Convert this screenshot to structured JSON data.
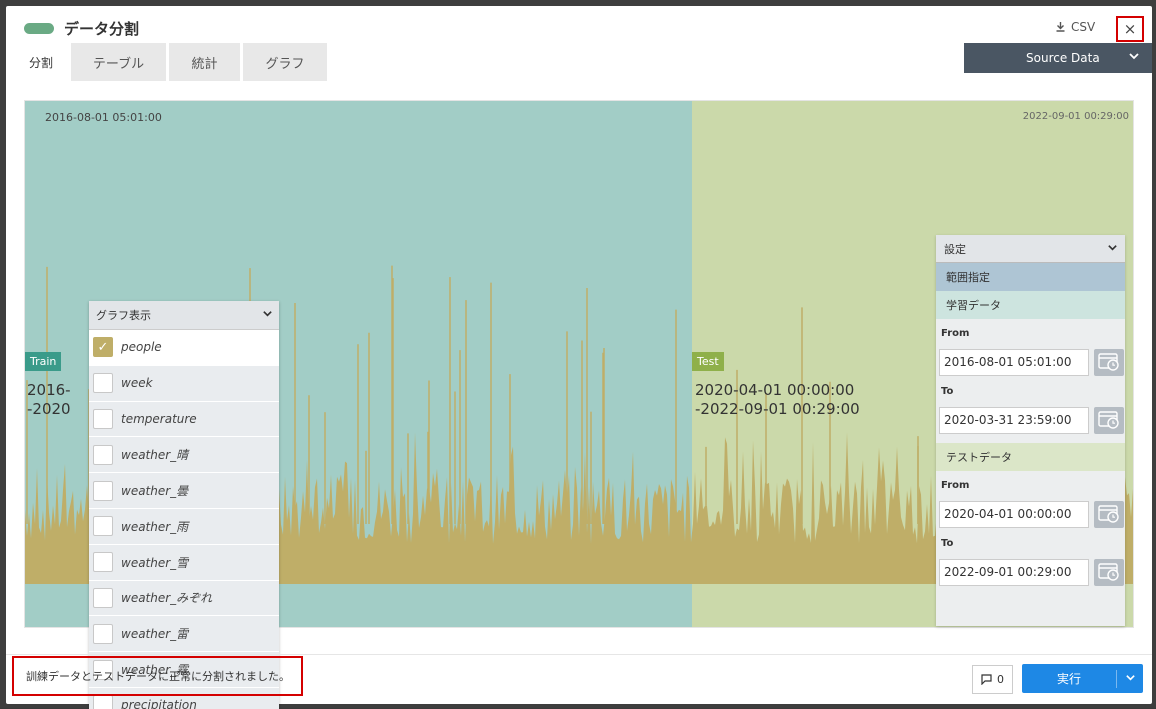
{
  "dialog": {
    "title": "データ分割",
    "csv_label": "CSV",
    "close_label": "×"
  },
  "tabs": [
    {
      "label": "分割"
    },
    {
      "label": "テーブル"
    },
    {
      "label": "統計"
    },
    {
      "label": "グラフ"
    }
  ],
  "source_select": {
    "label": "Source Data"
  },
  "chart": {
    "start_date": "2016-08-01 05:01:00",
    "end_date": "2022-09-01 00:29:00",
    "train_tag": "Train",
    "test_tag": "Test",
    "train_range_line1": "2016-",
    "train_range_line2": "-2020",
    "test_range_line1": "2020-04-01 00:00:00",
    "test_range_line2": "-2022-09-01 00:29:00",
    "colors": {
      "train_bg": "#a2cdc6",
      "test_bg": "#cbd9aa",
      "series": "#bfae68"
    },
    "train_fraction": 0.6
  },
  "graph_panel": {
    "title": "グラフ表示",
    "items": [
      {
        "label": "people",
        "checked": true
      },
      {
        "label": "week",
        "checked": false
      },
      {
        "label": "temperature",
        "checked": false
      },
      {
        "label": "weather_晴",
        "checked": false
      },
      {
        "label": "weather_曇",
        "checked": false
      },
      {
        "label": "weather_雨",
        "checked": false
      },
      {
        "label": "weather_雪",
        "checked": false
      },
      {
        "label": "weather_みぞれ",
        "checked": false
      },
      {
        "label": "weather_雷",
        "checked": false
      },
      {
        "label": "weather_霧",
        "checked": false
      },
      {
        "label": "precipitation",
        "checked": false
      }
    ]
  },
  "settings": {
    "title": "設定",
    "range_label": "範囲指定",
    "train_section": "学習データ",
    "test_section": "テストデータ",
    "from_label": "From",
    "to_label": "To",
    "train_from": "2016-08-01 05:01:00",
    "train_to": "2020-03-31 23:59:00",
    "test_from": "2020-04-01 00:00:00",
    "test_to": "2022-09-01 00:29:00"
  },
  "footer": {
    "status": "訓練データとテストデータに正常に分割されました。",
    "comment_count": "0",
    "run_label": "実行"
  }
}
